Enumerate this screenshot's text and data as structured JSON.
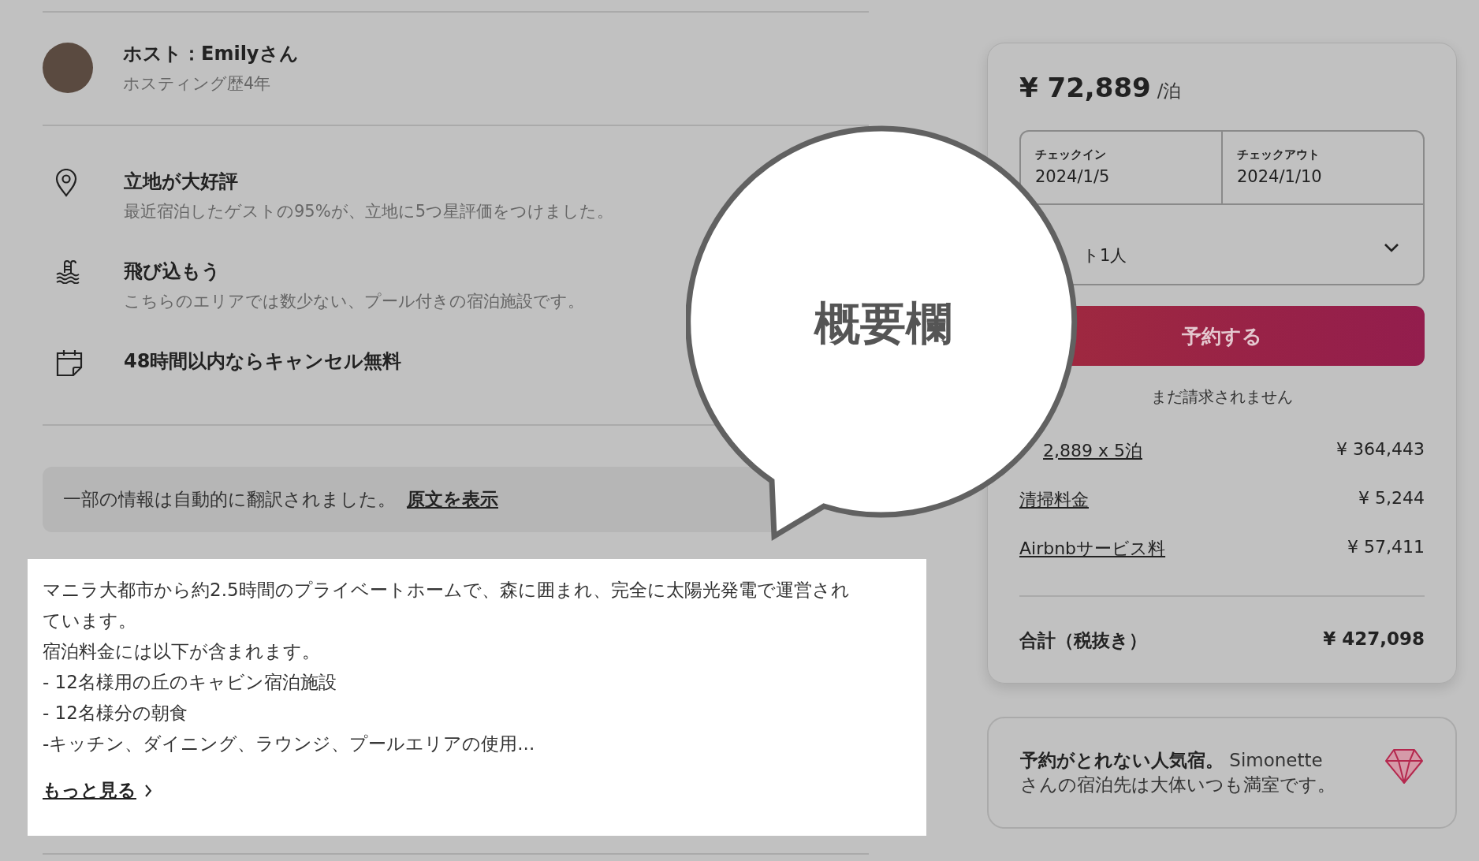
{
  "host": {
    "name": "ホスト：Emilyさん",
    "subtitle": "ホスティング歴4年"
  },
  "highlights": [
    {
      "kind": "location",
      "title": "立地が大好評",
      "subtitle": "最近宿泊したゲストの95%が、立地に5つ星評価をつけました。"
    },
    {
      "kind": "pool",
      "title": "飛び込もう",
      "subtitle": "こちらのエリアでは数少ない、プール付きの宿泊施設です。"
    },
    {
      "kind": "calendar",
      "title": "48時間以内ならキャンセル無料"
    }
  ],
  "translation_notice": {
    "text": "一部の情報は自動的に翻訳されました。",
    "link": "原文を表示"
  },
  "description": {
    "lines": [
      "マニラ大都市から約2.5時間のプライベートホームで、森に囲まれ、完全に太陽光発電で運営されています。",
      "宿泊料金には以下が含まれます。",
      "- 12名様用の丘のキャビン宿泊施設",
      "- 12名様分の朝食",
      "-キッチン、ダイニング、ラウンジ、プールエリアの使用..."
    ],
    "more_link": "もっと見る"
  },
  "booking": {
    "price": "¥ 72,889",
    "unit": "/泊",
    "checkin": {
      "label": "チェックイン",
      "value": "2024/1/5"
    },
    "checkout": {
      "label": "チェックアウト",
      "value": "2024/1/10"
    },
    "guests": {
      "value": "ト1人"
    },
    "reserve_button": "予約する",
    "note": "まだ請求されません",
    "fees": [
      {
        "label": "2,889 x 5泊",
        "amount": "¥ 364,443"
      },
      {
        "label": "清掃料金",
        "amount": "¥ 5,244"
      },
      {
        "label": "Airbnbサービス料",
        "amount": "¥ 57,411"
      }
    ],
    "total": {
      "label": "合計（税抜き）",
      "amount": "¥ 427,098"
    }
  },
  "rare_find": {
    "text": "**予約がとれない人気宿。** Simonetteさんの宿泊先は大体いつも満室です。"
  },
  "callout": {
    "text": "概要欄"
  }
}
